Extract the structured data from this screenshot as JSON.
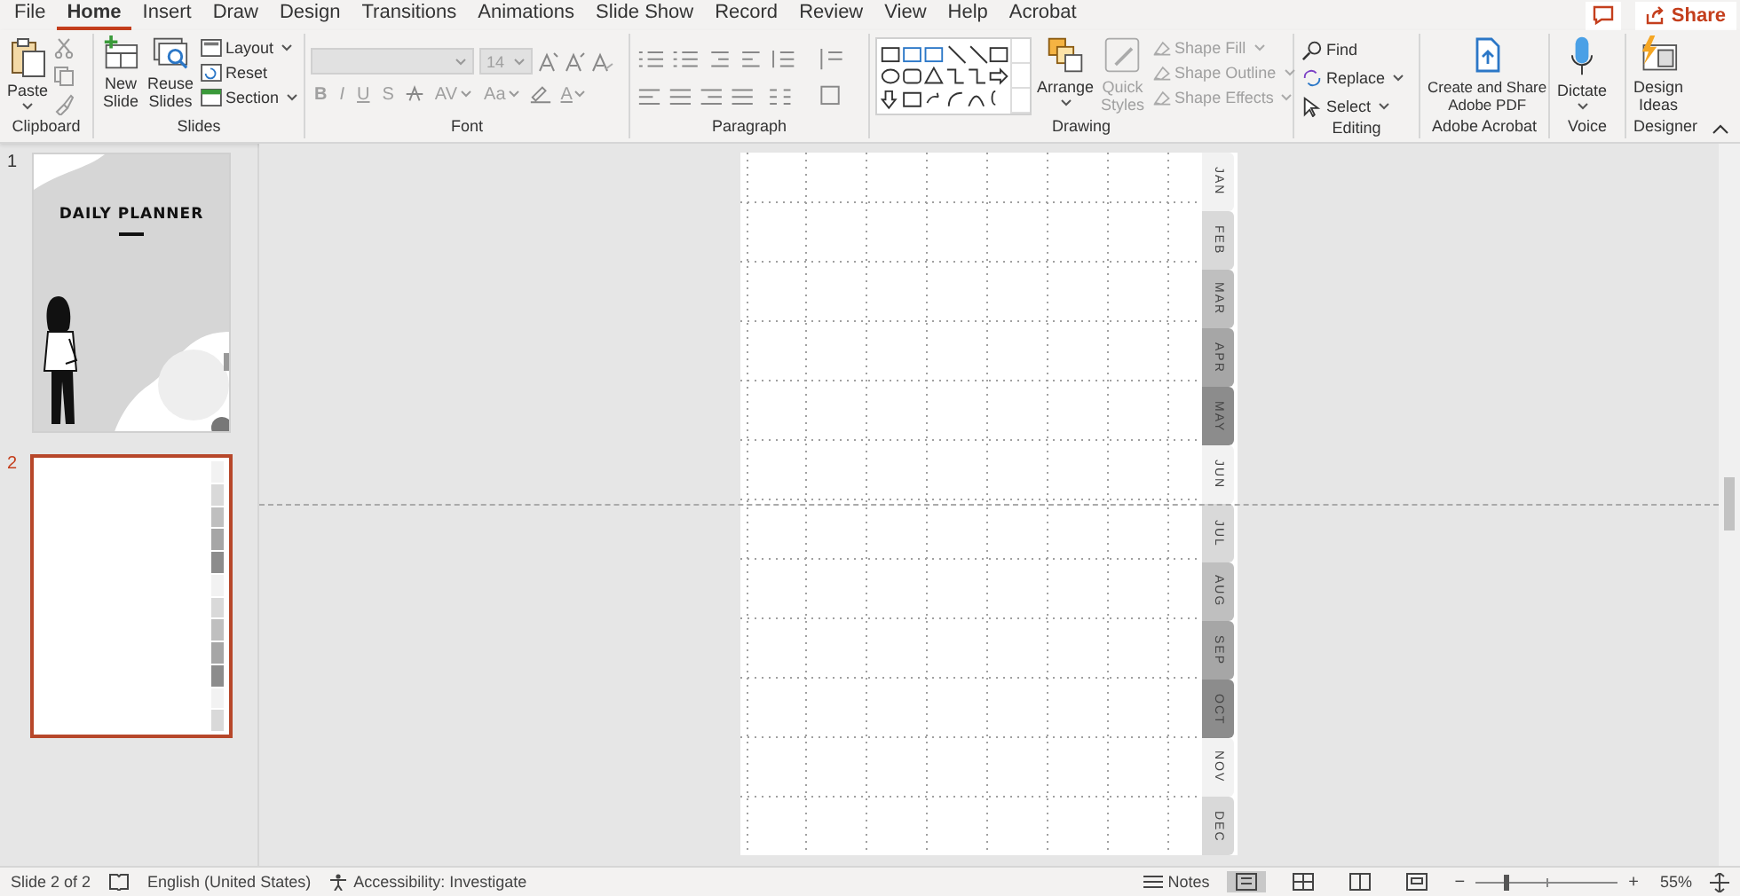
{
  "menu_tabs": [
    {
      "label": "File",
      "selected": false
    },
    {
      "label": "Home",
      "selected": true
    },
    {
      "label": "Insert",
      "selected": false
    },
    {
      "label": "Draw",
      "selected": false
    },
    {
      "label": "Design",
      "selected": false
    },
    {
      "label": "Transitions",
      "selected": false
    },
    {
      "label": "Animations",
      "selected": false
    },
    {
      "label": "Slide Show",
      "selected": false
    },
    {
      "label": "Record",
      "selected": false
    },
    {
      "label": "Review",
      "selected": false
    },
    {
      "label": "View",
      "selected": false
    },
    {
      "label": "Help",
      "selected": false
    },
    {
      "label": "Acrobat",
      "selected": false
    }
  ],
  "share_button": {
    "label": "Share"
  },
  "ribbon": {
    "clipboard": {
      "label": "Clipboard",
      "paste": "Paste"
    },
    "slides": {
      "label": "Slides",
      "new_slide": [
        "New",
        "Slide"
      ],
      "reuse_slides": [
        "Reuse",
        "Slides"
      ],
      "layout": "Layout",
      "reset": "Reset",
      "section": "Section"
    },
    "font": {
      "label": "Font",
      "size": "14",
      "disabled": true,
      "format_buttons": [
        "B",
        "I",
        "U",
        "S"
      ],
      "spacing": "AV",
      "case": "Aa",
      "font_color_letter": "A"
    },
    "paragraph": {
      "label": "Paragraph"
    },
    "drawing": {
      "label": "Drawing",
      "arrange": "Arrange",
      "quick_styles": {
        "lines": [
          "Quick",
          "Styles"
        ],
        "disabled": true
      },
      "shape_commands": [
        {
          "label": "Shape Fill",
          "disabled": true
        },
        {
          "label": "Shape Outline",
          "disabled": true
        },
        {
          "label": "Shape Effects",
          "disabled": true
        }
      ]
    },
    "editing": {
      "label": "Editing",
      "commands": [
        "Find",
        "Replace",
        "Select"
      ]
    },
    "acrobat": {
      "label": "Adobe Acrobat",
      "button": [
        "Create and Share",
        "Adobe PDF"
      ]
    },
    "voice": {
      "label": "Voice",
      "button": "Dictate"
    },
    "designer": {
      "label": "Designer",
      "button": [
        "Design",
        "Ideas"
      ]
    }
  },
  "thumbnails": [
    {
      "number": "1",
      "selected": false,
      "title": "DAILY PLANNER"
    },
    {
      "number": "2",
      "selected": true
    }
  ],
  "slide": {
    "month_tabs": [
      {
        "label": "JAN",
        "color": "#f2f2f2"
      },
      {
        "label": "FEB",
        "color": "#d9d9d9"
      },
      {
        "label": "MAR",
        "color": "#bfbfbf"
      },
      {
        "label": "APR",
        "color": "#a6a6a6"
      },
      {
        "label": "MAY",
        "color": "#8c8c8c"
      },
      {
        "label": "JUN",
        "color": "#f2f2f2"
      },
      {
        "label": "JUL",
        "color": "#d9d9d9"
      },
      {
        "label": "AUG",
        "color": "#bfbfbf"
      },
      {
        "label": "SEP",
        "color": "#a6a6a6"
      },
      {
        "label": "OCT",
        "color": "#8c8c8c"
      },
      {
        "label": "NOV",
        "color": "#f2f2f2"
      },
      {
        "label": "DEC",
        "color": "#d9d9d9"
      }
    ]
  },
  "status_bar": {
    "slide_position": "Slide 2 of 2",
    "language": "English (United States)",
    "accessibility": "Accessibility: Investigate",
    "notes": "Notes",
    "views": [
      {
        "selected": true
      },
      {
        "selected": false
      },
      {
        "selected": false
      },
      {
        "selected": false
      }
    ],
    "zoom_minus": "−",
    "zoom_plus": "+",
    "zoom": {
      "level": 0.2
    },
    "zoom_percent": "55%"
  }
}
